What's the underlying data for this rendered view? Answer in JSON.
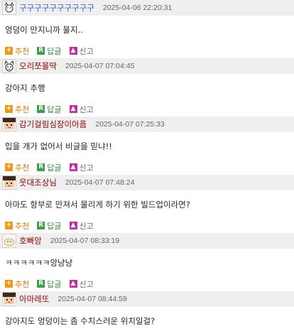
{
  "actions": {
    "recommend": "추천",
    "reply": "답글",
    "report": "신고"
  },
  "icons": {
    "recommend": "plus-icon",
    "reply": "reply-icon",
    "report": "report-icon"
  },
  "icon_glyphs": {
    "recommend": "+",
    "reply": "R",
    "report": "▲"
  },
  "colors": {
    "header_bg": "#efefef",
    "time": "#666666"
  },
  "comments": [
    {
      "nick": "구구구구구구구구구구",
      "nick_color": "#3a5fcd",
      "time": "2025-04-06 22:20:31",
      "text": "엉덩이 만지니까 물지..",
      "avatar": "cat-avatar"
    },
    {
      "nick": "오리쪼물딱",
      "nick_color": "#8b0000",
      "time": "2025-04-07 07:04:45",
      "text": "강아지 추행",
      "avatar": "cat-avatar"
    },
    {
      "nick": "감기걸림심장이아픔",
      "nick_color": "#8b0000",
      "time": "2025-04-07 07:25:33",
      "text": "입을 개가 없어서 비글을 믿냐!!",
      "avatar": "pixel-face-avatar"
    },
    {
      "nick": "웃대조상님",
      "nick_color": "#8b0000",
      "time": "2025-04-07 07:48:24",
      "text": "아마도 항부로 만져서 물리게 하기 위한 빌드업이라면?",
      "avatar": "pixel-face-avatar"
    },
    {
      "nick": "호빠앙",
      "nick_color": "#8b0000",
      "time": "2025-04-07 08:33:19",
      "text": "ㅋㅋㅋㅋㅋㅋ앙냥냥",
      "avatar": "bread-avatar"
    },
    {
      "nick": "아마레또",
      "nick_color": "#8b0000",
      "time": "2025-04-07 08:44:59",
      "text": "강아지도 엉덩이는 좀 수치스러운 위치일걸?",
      "avatar": "pixel-face-avatar"
    }
  ]
}
